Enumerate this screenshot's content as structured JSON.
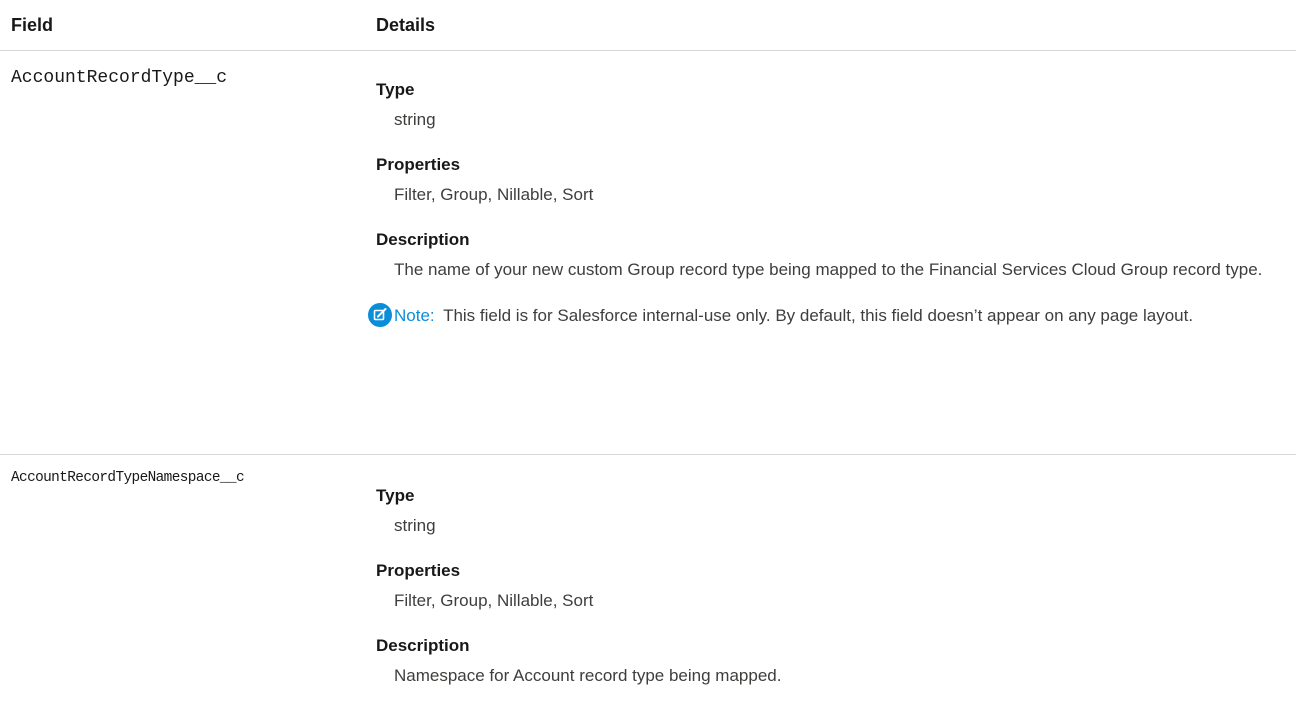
{
  "table": {
    "headers": {
      "field": "Field",
      "details": "Details"
    },
    "rows": [
      {
        "field_name": "AccountRecordType__c",
        "type_label": "Type",
        "type_value": "string",
        "properties_label": "Properties",
        "properties_value": "Filter, Group, Nillable, Sort",
        "description_label": "Description",
        "description_value": "The name of your new custom Group record type being mapped to the Financial Services Cloud Group record type.",
        "note_label": "Note:",
        "note_text": "This field is for Salesforce internal-use only. By default, this field doesn’t appear on any page layout."
      },
      {
        "field_name": "AccountRecordTypeNamespace__c",
        "type_label": "Type",
        "type_value": "string",
        "properties_label": "Properties",
        "properties_value": "Filter, Group, Nillable, Sort",
        "description_label": "Description",
        "description_value": "Namespace for Account record type being mapped."
      }
    ]
  },
  "colors": {
    "note_accent": "#0b8ed9",
    "divider": "#d8d8d8"
  },
  "icons": {
    "note": "edit-note-icon"
  }
}
